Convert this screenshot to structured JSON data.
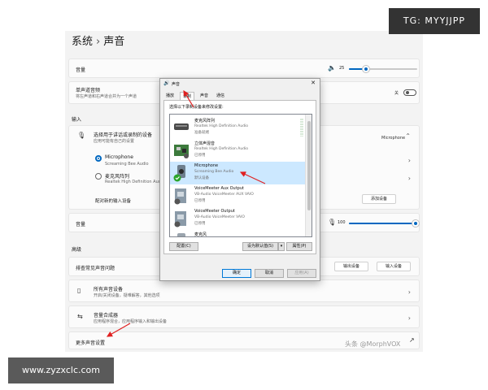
{
  "breadcrumb": {
    "parent": "系统",
    "separator": "›",
    "current": "声音"
  },
  "output_volume": {
    "label": "音量",
    "value": "25",
    "level": 25
  },
  "mono_audio": {
    "title": "单声道音频",
    "desc": "将左声道和右声道合并为一个声道",
    "state": "关"
  },
  "input_section": "输入",
  "input_choose": {
    "title": "选择用于讲话或录制的设备",
    "desc": "应用可能有自己的设置",
    "current": "Microphone"
  },
  "input_devices": [
    {
      "name": "Microphone",
      "sub": "Screaming Bee Audio",
      "selected": true
    },
    {
      "name": "麦克风阵列",
      "sub": "Realtek High Definition Audio",
      "selected": false
    }
  ],
  "pair_device": {
    "label": "配对新的输入设备",
    "button": "添加设备"
  },
  "input_volume": {
    "label": "音量",
    "value": "100",
    "level": 100
  },
  "advanced_section": "高级",
  "troubleshoot": {
    "label": "排查常见声音问题",
    "output_btn": "输出设备",
    "input_btn": "输入设备"
  },
  "all_devices": {
    "title": "所有声音设备",
    "desc": "开启/关闭设备，疑难解答，其他选项"
  },
  "mixer": {
    "title": "音量合成器",
    "desc": "应用程序混合，应用程序输入和输出设备"
  },
  "more_settings": "更多声音设置",
  "dialog": {
    "title": "声音",
    "tabs": [
      "播放",
      "录制",
      "声音",
      "通信"
    ],
    "active_tab": 1,
    "instruction": "选择以下录制设备来修改设置:",
    "devices": [
      {
        "name": "麦克风阵列",
        "l2": "Realtek High Definition Audio",
        "l3": "准备就绪",
        "selected": false
      },
      {
        "name": "立体声混音",
        "l2": "Realtek High Definition Audio",
        "l3": "已停用",
        "selected": false
      },
      {
        "name": "Microphone",
        "l2": "Screaming Bee Audio",
        "l3": "默认设备",
        "selected": true
      },
      {
        "name": "VoiceMeeter Aux Output",
        "l2": "VB-Audio VoiceMeeter AUX VAIO",
        "l3": "已停用",
        "selected": false
      },
      {
        "name": "VoiceMeeter Output",
        "l2": "VB-Audio VoiceMeeter VAIO",
        "l3": "已停用",
        "selected": false
      },
      {
        "name": "麦克风",
        "l2": "",
        "l3": "",
        "selected": false
      }
    ],
    "configure": "配置(C)",
    "set_default": "设为默认值(S)",
    "properties": "属性(P)",
    "ok": "确定",
    "cancel": "取消",
    "apply": "应用(A)"
  },
  "overlays": {
    "tg": "TG: MYYJJPP",
    "site": "www.zyzxclc.com",
    "watermark": "头条 @MorphVOX"
  },
  "colors": {
    "accent": "#0067c0",
    "arrow": "#e02020",
    "selection": "#cce8ff"
  }
}
